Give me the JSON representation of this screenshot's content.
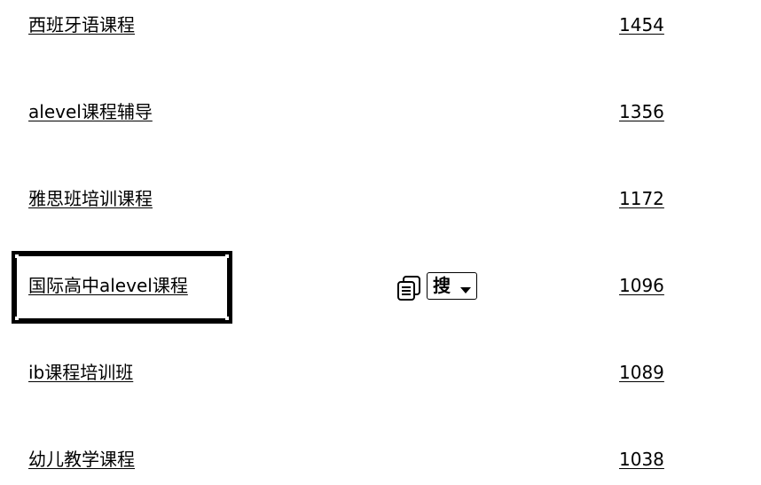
{
  "rows": [
    {
      "keyword": "西班牙语课程",
      "count": "1454"
    },
    {
      "keyword": "alevel课程辅导",
      "count": "1356"
    },
    {
      "keyword": "雅思班培训课程",
      "count": "1172"
    },
    {
      "keyword": "国际高中alevel课程",
      "count": "1096"
    },
    {
      "keyword": "ib课程培训班",
      "count": "1089"
    },
    {
      "keyword": "幼儿教学课程",
      "count": "1038"
    }
  ],
  "toolbar": {
    "search_label": "搜",
    "copy_icon": "copy-icon",
    "dropdown_icon": "caret-down-icon"
  }
}
